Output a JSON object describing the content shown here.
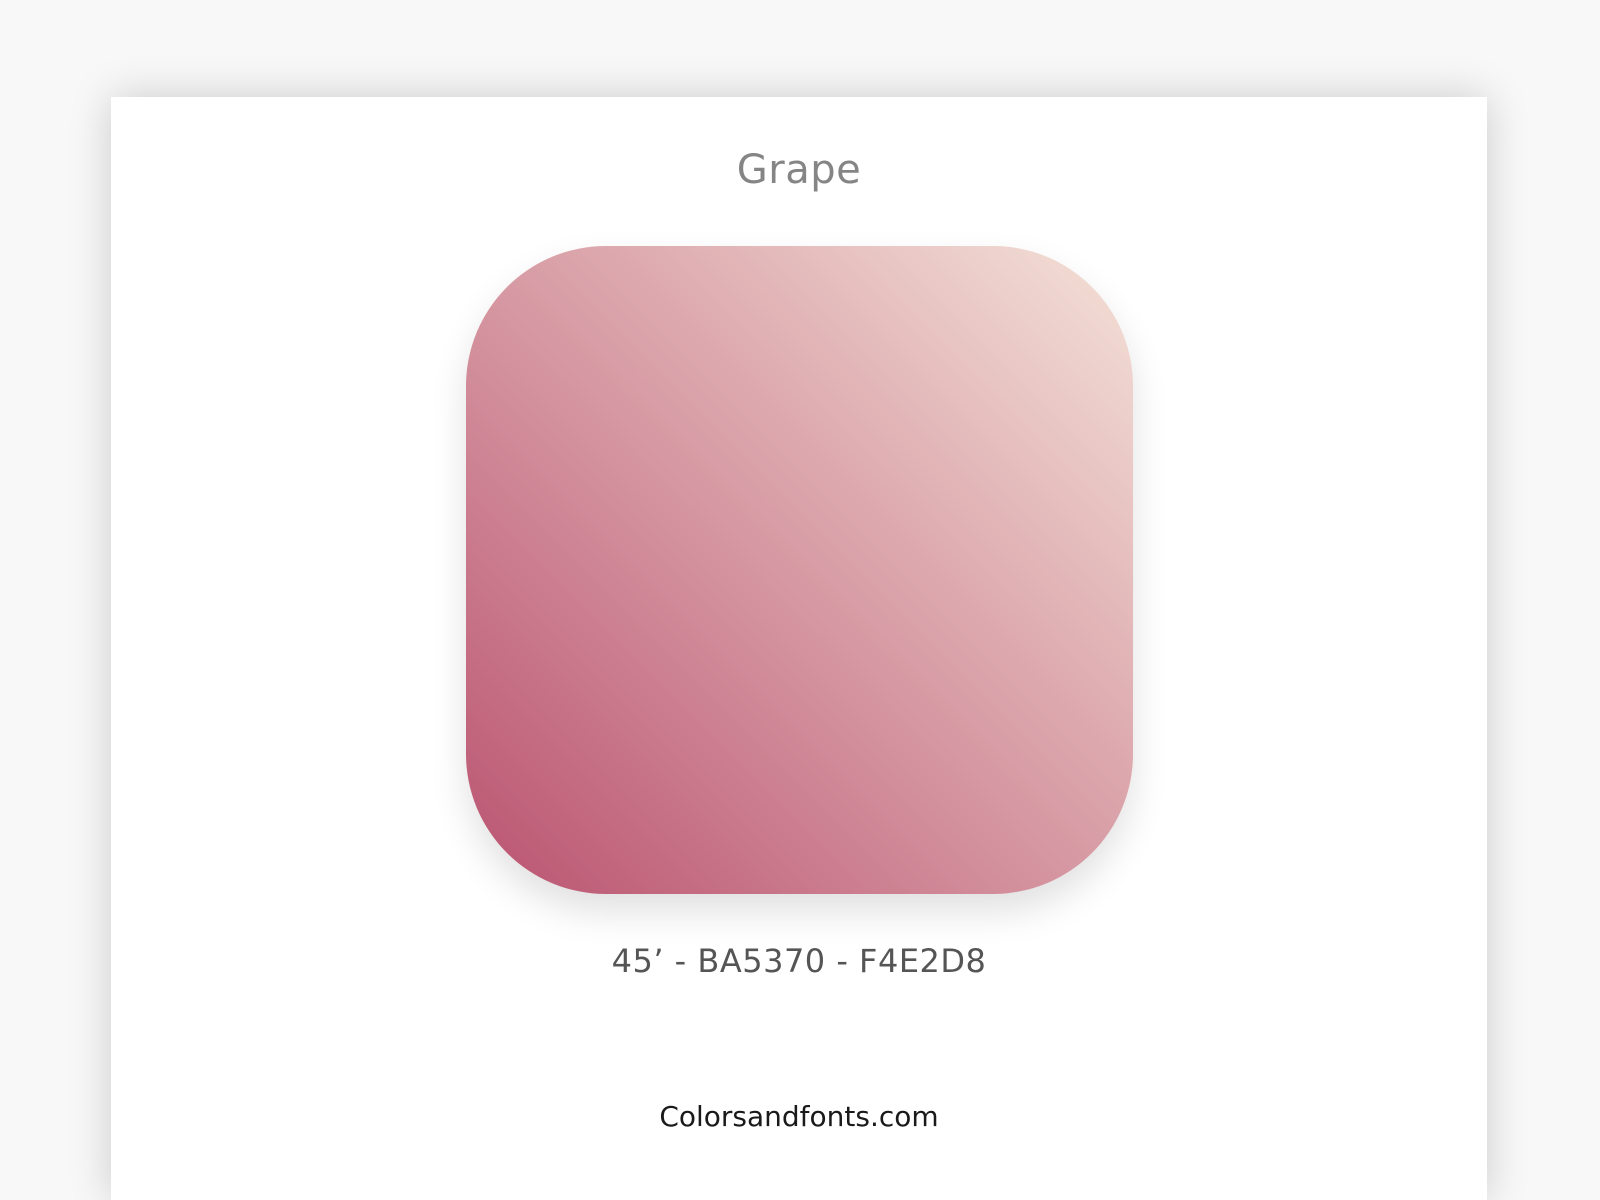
{
  "palette": {
    "name": "Grape",
    "angle": "45’",
    "color_start": "BA5370",
    "color_end": "F4E2D8",
    "codes_text": "45’ - BA5370 - F4E2D8",
    "start_hex": "#BA5370",
    "end_hex": "#F4E2D8"
  },
  "footer": {
    "site": "Colorsandfonts.com"
  }
}
